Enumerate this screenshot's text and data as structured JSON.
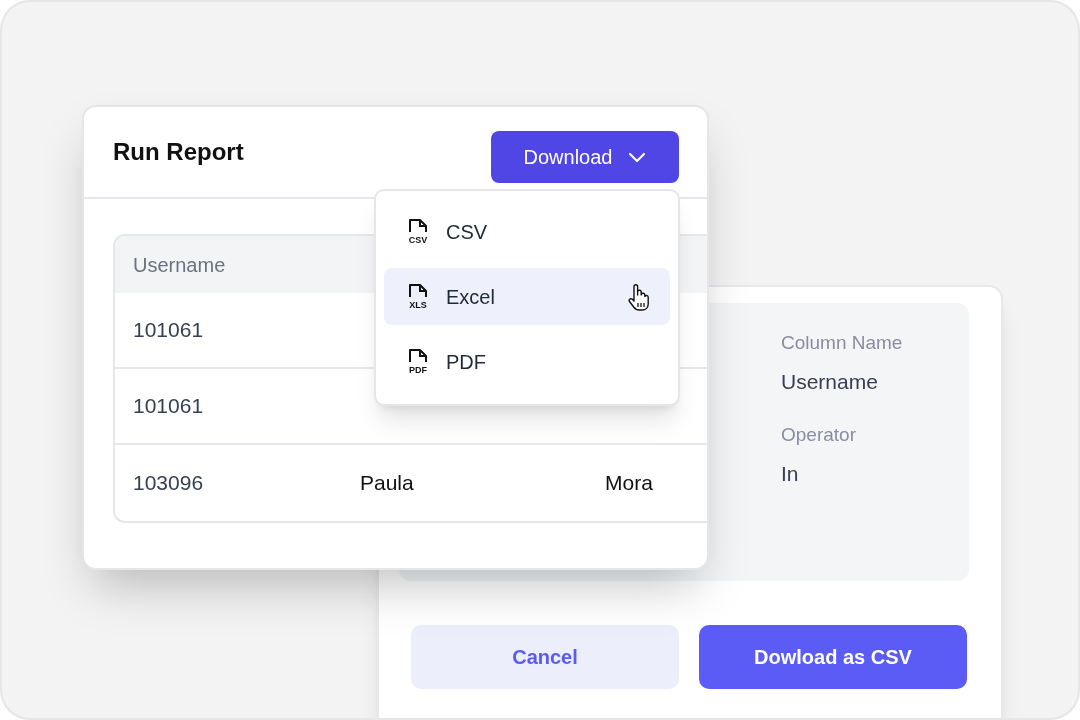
{
  "report": {
    "title": "Run Report",
    "download_button": "Download",
    "menu": [
      {
        "icon_label": "CSV",
        "label": "CSV",
        "selected": false
      },
      {
        "icon_label": "XLS",
        "label": "Excel",
        "selected": true
      },
      {
        "icon_label": "PDF",
        "label": "PDF",
        "selected": false
      }
    ],
    "table": {
      "columns": {
        "column_1": "Username"
      },
      "rows": [
        {
          "column_1": "101061"
        },
        {
          "column_1": "101061"
        },
        {
          "column_1": "103096",
          "column_2": "Paula",
          "column_3": "Mora"
        }
      ]
    }
  },
  "filter_panel": {
    "fields": [
      {
        "label": "Column Name",
        "value": "Username"
      },
      {
        "label": "Operator",
        "value": "In"
      }
    ],
    "buttons": [
      {
        "kind": "secondary",
        "label": "Cancel"
      },
      {
        "kind": "primary",
        "label": "Dowload as CSV"
      }
    ]
  }
}
